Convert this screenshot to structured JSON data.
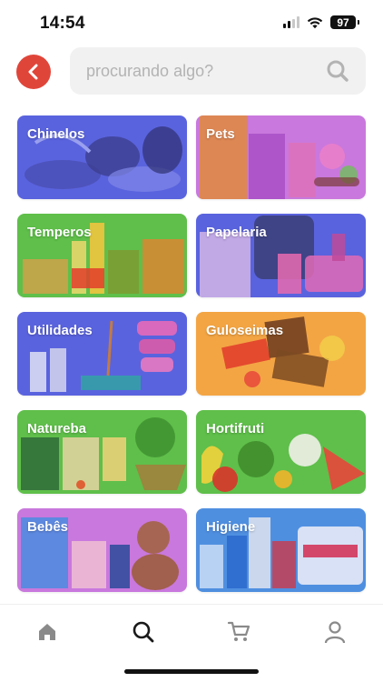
{
  "status_bar": {
    "time": "14:54",
    "battery": "97"
  },
  "search": {
    "placeholder": "procurando algo?",
    "value": ""
  },
  "categories": [
    {
      "label": "Chinelos",
      "color": "#5a63de"
    },
    {
      "label": "Pets",
      "color": "#c978dd"
    },
    {
      "label": "Temperos",
      "color": "#5fbf4a"
    },
    {
      "label": "Papelaria",
      "color": "#5a63de"
    },
    {
      "label": "Utilidades",
      "color": "#5a63de"
    },
    {
      "label": "Guloseimas",
      "color": "#f3a544"
    },
    {
      "label": "Natureba",
      "color": "#5fbf4a"
    },
    {
      "label": "Hortifruti",
      "color": "#5fbf4a"
    },
    {
      "label": "Bebês",
      "color": "#c978dd"
    },
    {
      "label": "Higiene",
      "color": "#4f8fe0"
    }
  ],
  "bottom_nav": {
    "items": [
      {
        "icon": "home-icon"
      },
      {
        "icon": "search-icon"
      },
      {
        "icon": "cart-icon"
      },
      {
        "icon": "user-icon"
      }
    ]
  },
  "colors": {
    "accent": "#e0453a",
    "search_bg": "#f1f1f1"
  }
}
